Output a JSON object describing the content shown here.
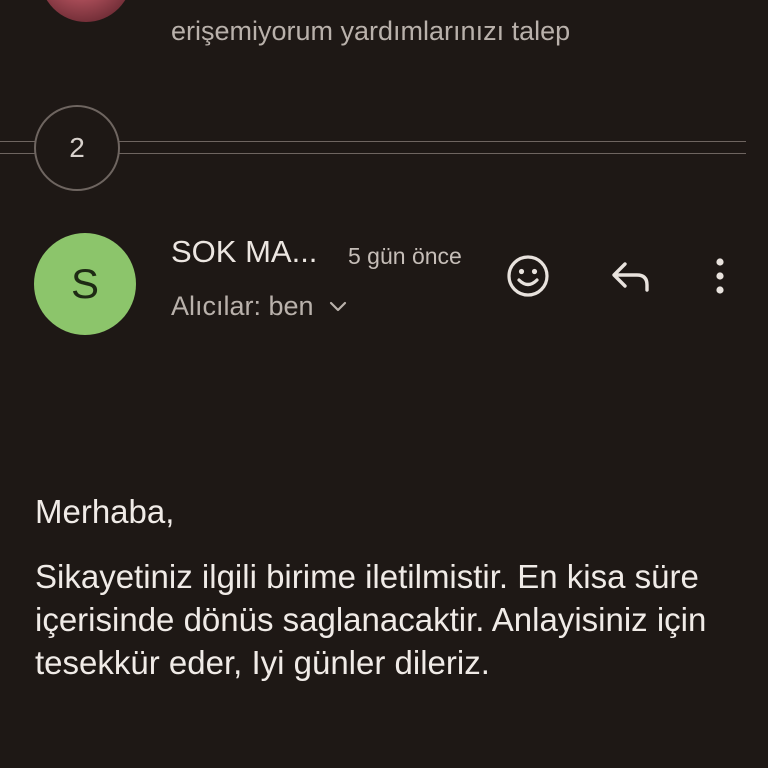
{
  "previous_message": {
    "snippet_partial": "erişemiyorum yardımlarınızı talep"
  },
  "collapsed": {
    "count": "2"
  },
  "message": {
    "avatar_letter": "S",
    "sender": "SOK MA...",
    "time": "5 gün önce",
    "recipients": "Alıcılar: ben",
    "body": {
      "greeting": "Merhaba,",
      "paragraph": "Sikayetiniz ilgili birime iletilmistir. En kisa süre içerisinde dönüs saglanacaktir. Anlayisiniz için tesekkür eder, Iyi günler dileriz."
    }
  },
  "icons": {
    "emoji": "emoji-icon",
    "reply": "reply-icon",
    "more": "more-vert-icon",
    "expand": "chevron-down-icon"
  },
  "colors": {
    "background": "#1e1815",
    "avatar": "#8cc56b"
  }
}
